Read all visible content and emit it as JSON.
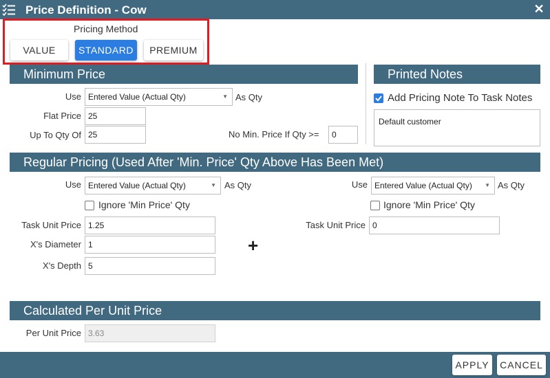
{
  "window": {
    "title": "Price Definition - Cow"
  },
  "pricing_method": {
    "label": "Pricing Method",
    "options": [
      "VALUE",
      "STANDARD",
      "PREMIUM"
    ],
    "selected": "STANDARD"
  },
  "minimum_price": {
    "header": "Minimum Price",
    "use_label": "Use",
    "use_value": "Entered Value (Actual Qty)",
    "as_qty": "As Qty",
    "flat_price_label": "Flat Price",
    "flat_price_value": "25",
    "up_to_qty_label": "Up To Qty Of",
    "up_to_qty_value": "25",
    "no_min_label": "No Min. Price If Qty >=",
    "no_min_value": "0"
  },
  "printed_notes": {
    "header": "Printed Notes",
    "add_note_label": "Add Pricing Note To Task Notes",
    "add_note_checked": true,
    "note_text": "Default customer"
  },
  "regular_pricing": {
    "header": "Regular Pricing (Used After 'Min. Price' Qty Above Has Been Met)",
    "left": {
      "use_label": "Use",
      "use_value": "Entered Value (Actual Qty)",
      "as_qty": "As Qty",
      "ignore_label": "Ignore 'Min Price' Qty",
      "ignore_checked": false,
      "task_unit_price_label": "Task Unit Price",
      "task_unit_price_value": "1.25",
      "diameter_label": "X's Diameter",
      "diameter_value": "1",
      "depth_label": "X's Depth",
      "depth_value": "5"
    },
    "right": {
      "use_label": "Use",
      "use_value": "Entered Value (Actual Qty)",
      "as_qty": "As Qty",
      "ignore_label": "Ignore 'Min Price' Qty",
      "ignore_checked": false,
      "task_unit_price_label": "Task Unit Price",
      "task_unit_price_value": "0"
    },
    "plus_symbol": "+"
  },
  "calculated": {
    "header": "Calculated Per Unit Price",
    "per_unit_label": "Per Unit Price",
    "per_unit_value": "3.63"
  },
  "footer": {
    "apply_label": "APPLY",
    "cancel_label": "CANCEL"
  },
  "colors": {
    "header_bg": "#41697f",
    "accent": "#2b7de1",
    "highlight_box": "#e01b22"
  },
  "icons": {
    "menu": "checklist-icon",
    "close": "close-icon",
    "dropdown": "chevron-down-icon",
    "check": "checkmark-icon"
  }
}
